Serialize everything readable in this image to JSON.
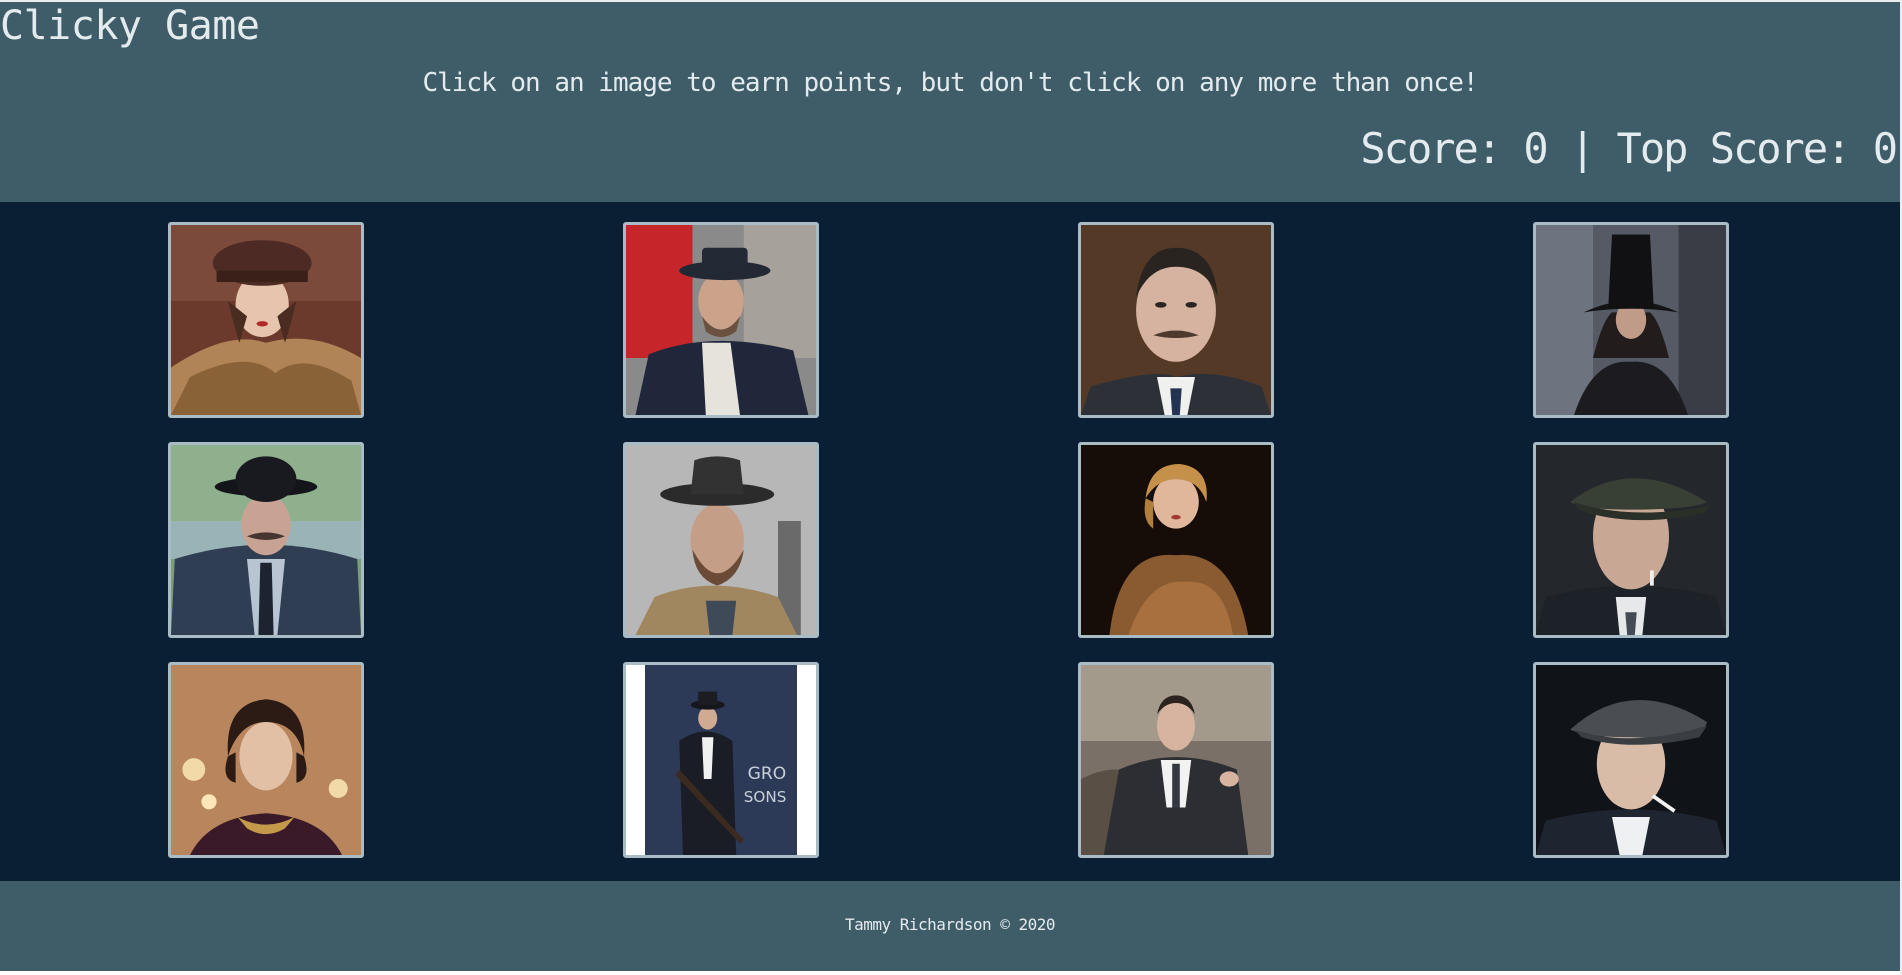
{
  "header": {
    "title": "Clicky Game",
    "instructions": "Click on an image to earn points, but don't click on any more than once!",
    "score_label": "Score: ",
    "score": "0",
    "separator": " | ",
    "top_score_label": "Top Score: ",
    "top_score": "0"
  },
  "cards": [
    {
      "name": "card-woman-brown-hat-fur-coat",
      "icon": "portrait-woman-hat"
    },
    {
      "name": "card-man-flat-top-hat-red-door",
      "icon": "portrait-man-pork-pie-hat"
    },
    {
      "name": "card-man-mustache-undercut",
      "icon": "portrait-man-mustache"
    },
    {
      "name": "card-woman-black-hat",
      "icon": "portrait-woman-black-hat"
    },
    {
      "name": "card-man-bowler-hat-suit",
      "icon": "portrait-man-bowler-hat"
    },
    {
      "name": "card-man-fedora-beard",
      "icon": "portrait-man-fedora"
    },
    {
      "name": "card-woman-blonde-fur",
      "icon": "portrait-woman-blonde"
    },
    {
      "name": "card-man-flat-cap",
      "icon": "portrait-man-flat-cap"
    },
    {
      "name": "card-woman-dark-hair-necklace",
      "icon": "portrait-woman-necklace"
    },
    {
      "name": "card-man-tommy-gun",
      "icon": "portrait-man-tommy-gun"
    },
    {
      "name": "card-man-seated-suit",
      "icon": "portrait-man-seated"
    },
    {
      "name": "card-man-cap-cigarette",
      "icon": "portrait-man-cap-cigarette"
    }
  ],
  "footer": {
    "text": "Tammy Richardson © 2020"
  }
}
